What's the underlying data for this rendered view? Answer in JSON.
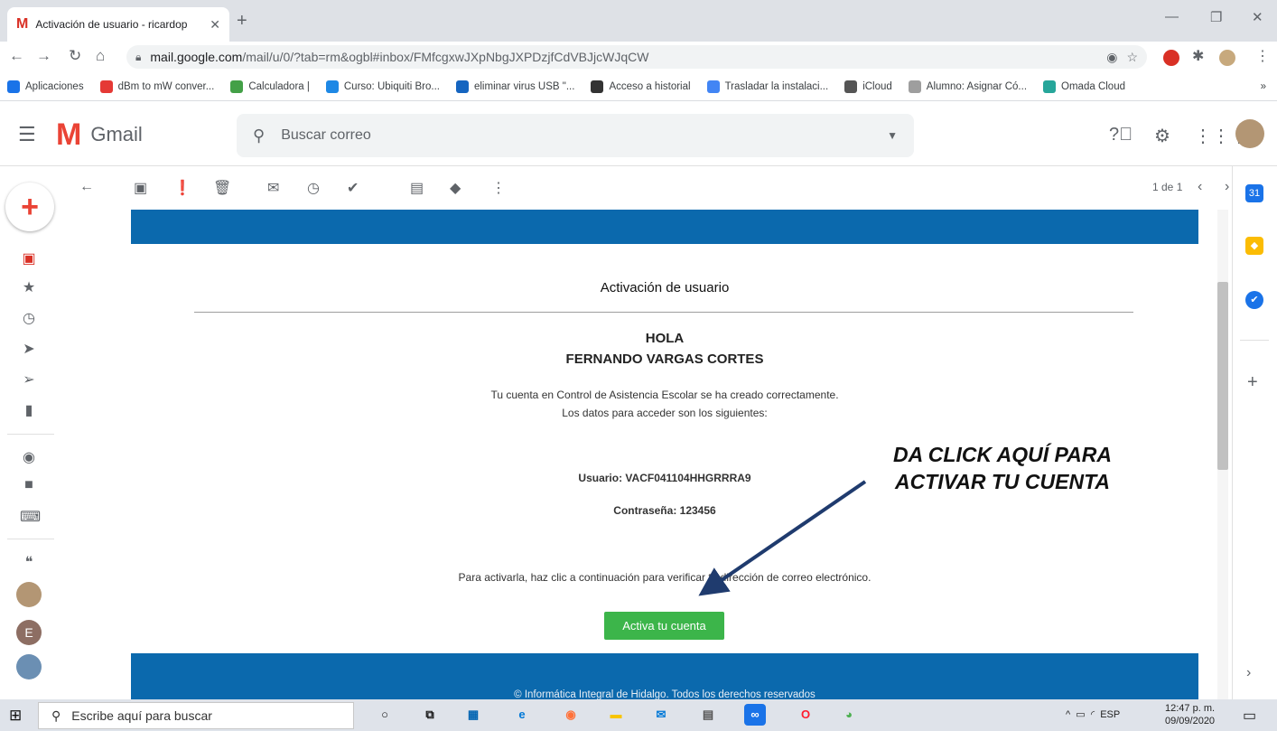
{
  "browser": {
    "tab_title": "Activación de usuario - ricardop",
    "url_host": "mail.google.com",
    "url_path": "/mail/u/0/?tab=rm&ogbl#inbox/FMfcgxwJXpNbgJXPDzjfCdVBJjcWJqCW",
    "bookmarks": [
      {
        "label": "Aplicaciones",
        "color": "#1a73e8"
      },
      {
        "label": "dBm to mW conver...",
        "color": "#e53935"
      },
      {
        "label": "Calculadora |",
        "color": "#43a047"
      },
      {
        "label": "Curso: Ubiquiti Bro...",
        "color": "#1e88e5"
      },
      {
        "label": "eliminar virus USB \"...",
        "color": "#1565c0"
      },
      {
        "label": "Acceso a historial",
        "color": "#333333"
      },
      {
        "label": "Trasladar la instalaci...",
        "color": "#4285f4"
      },
      {
        "label": "iCloud",
        "color": "#555555"
      },
      {
        "label": "Alumno: Asignar Có...",
        "color": "#9e9e9e"
      },
      {
        "label": "Omada Cloud",
        "color": "#26a69a"
      }
    ],
    "bookmarks_more": "»"
  },
  "gmail": {
    "logo_text": "Gmail",
    "search_placeholder": "Buscar correo",
    "page_count": "1 de 1"
  },
  "email": {
    "title": "Activación de usuario",
    "greeting": "HOLA",
    "user_name": "FERNANDO VARGAS CORTES",
    "line1": "Tu cuenta en Control de Asistencia Escolar se ha creado correctamente.",
    "line2": "Los datos para acceder son los siguientes:",
    "usuario": "Usuario: VACF041104HHGRRRA9",
    "password": "Contraseña: 123456",
    "activate_text": "Para activarla, haz clic a continuación para verificar tu dirección de correo electrónico.",
    "button_label": "Activa tu cuenta",
    "copyright": "©  Informática Integral de Hidalgo. Todos los derechos reservados"
  },
  "annotation": {
    "line1": "DA CLICK AQUÍ PARA",
    "line2": "ACTIVAR TU CUENTA"
  },
  "taskbar": {
    "search_placeholder": "Escribe aquí para buscar",
    "language": "ESP",
    "time": "12:47 p. m.",
    "date": "09/09/2020"
  },
  "colors": {
    "banner": "#0b69ad",
    "button": "#3cb54a",
    "gmail_red": "#ea4335"
  }
}
